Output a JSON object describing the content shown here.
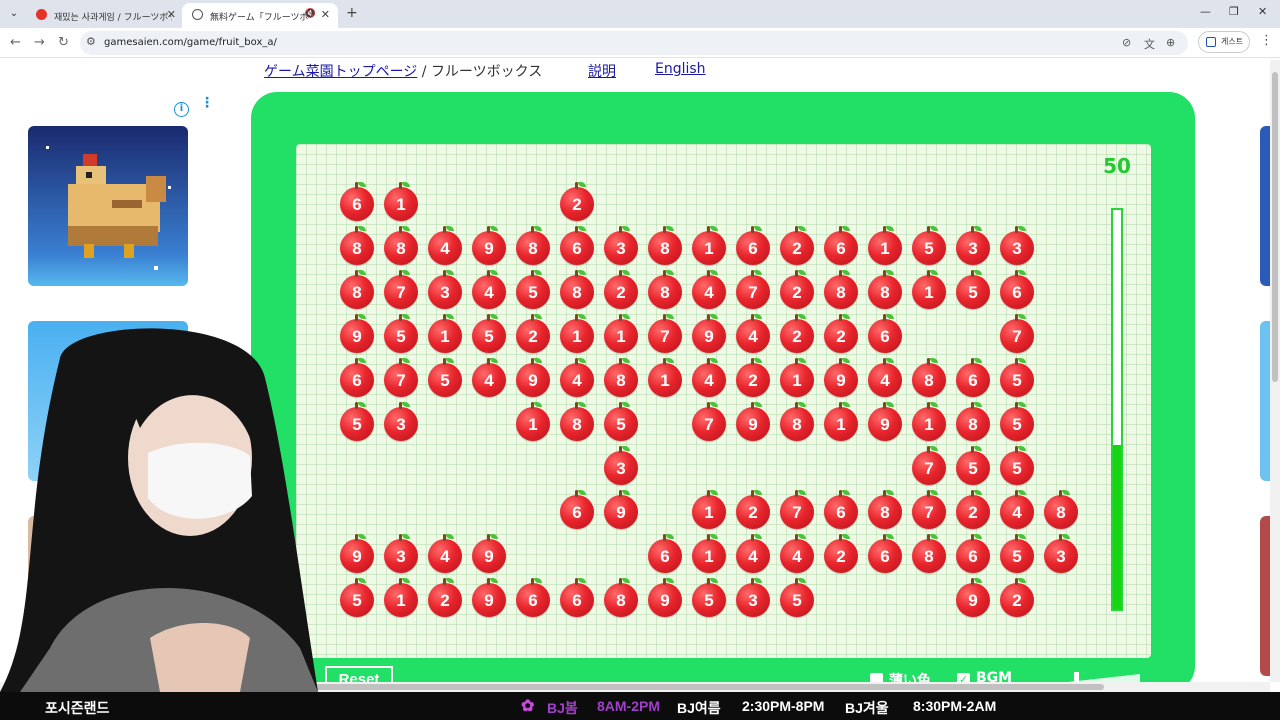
{
  "browser": {
    "tabs": [
      {
        "title": "재밌는 사과게임 / フルーツボックス"
      },
      {
        "title": "無料ゲーム「フルーツボックス」"
      }
    ],
    "url": "gamesaien.com/game/fruit_box_a/",
    "profile_label": "게스트"
  },
  "site_nav": {
    "home_link": "ゲーム菜園トップページ",
    "separator": " / ",
    "current": "フルーツボックス",
    "help_link": "説明",
    "english_link": "English"
  },
  "game": {
    "score": "50",
    "timer_fraction": 0.41,
    "reset_label": "Reset",
    "option_light_color": "薄い色",
    "option_bgm": "BGM",
    "light_color_checked": false,
    "bgm_checked": true,
    "grid": [
      [
        "6",
        "1",
        "",
        "",
        "",
        "2",
        "",
        "",
        "",
        "",
        "",
        "",
        "",
        "",
        "",
        ""
      ],
      [
        "8",
        "8",
        "4",
        "9",
        "8",
        "6",
        "3",
        "8",
        "1",
        "6",
        "2",
        "6",
        "1",
        "5",
        "3",
        "3"
      ],
      [
        "8",
        "7",
        "3",
        "4",
        "5",
        "8",
        "2",
        "8",
        "4",
        "7",
        "2",
        "8",
        "8",
        "1",
        "5",
        "6"
      ],
      [
        "9",
        "5",
        "1",
        "5",
        "2",
        "1",
        "1",
        "7",
        "9",
        "4",
        "2",
        "2",
        "6",
        "",
        "",
        "7"
      ],
      [
        "6",
        "7",
        "5",
        "4",
        "9",
        "4",
        "8",
        "1",
        "4",
        "2",
        "1",
        "9",
        "4",
        "8",
        "6",
        "5"
      ],
      [
        "5",
        "3",
        "",
        "",
        "1",
        "8",
        "5",
        "",
        "7",
        "9",
        "8",
        "1",
        "9",
        "1",
        "8",
        "5"
      ],
      [
        "",
        "",
        "",
        "",
        "",
        "",
        "3",
        "",
        "",
        "",
        "",
        "",
        "",
        "7",
        "5",
        "5"
      ],
      [
        "",
        "",
        "",
        "",
        "",
        "6",
        "9",
        "",
        "1",
        "2",
        "7",
        "6",
        "8",
        "7",
        "2",
        "4",
        "8"
      ],
      [
        "9",
        "3",
        "4",
        "9",
        "",
        "",
        "",
        "6",
        "1",
        "4",
        "4",
        "2",
        "6",
        "8",
        "6",
        "5",
        "3"
      ],
      [
        "5",
        "1",
        "2",
        "9",
        "6",
        "6",
        "8",
        "9",
        "5",
        "3",
        "5",
        "",
        "",
        "",
        "9",
        "2"
      ]
    ]
  },
  "stream_overlay": {
    "brand": "포시즌랜드",
    "schedule": [
      {
        "name": "BJ봄",
        "time": "8AM-2PM"
      },
      {
        "name": "BJ여름",
        "time": "2:30PM-8PM"
      },
      {
        "name": "BJ겨울",
        "time": "8:30PM-2AM"
      }
    ]
  },
  "colors": {
    "frame_green": "#22df66",
    "apple_red": "#e8252d",
    "score_green": "#22c92f"
  }
}
